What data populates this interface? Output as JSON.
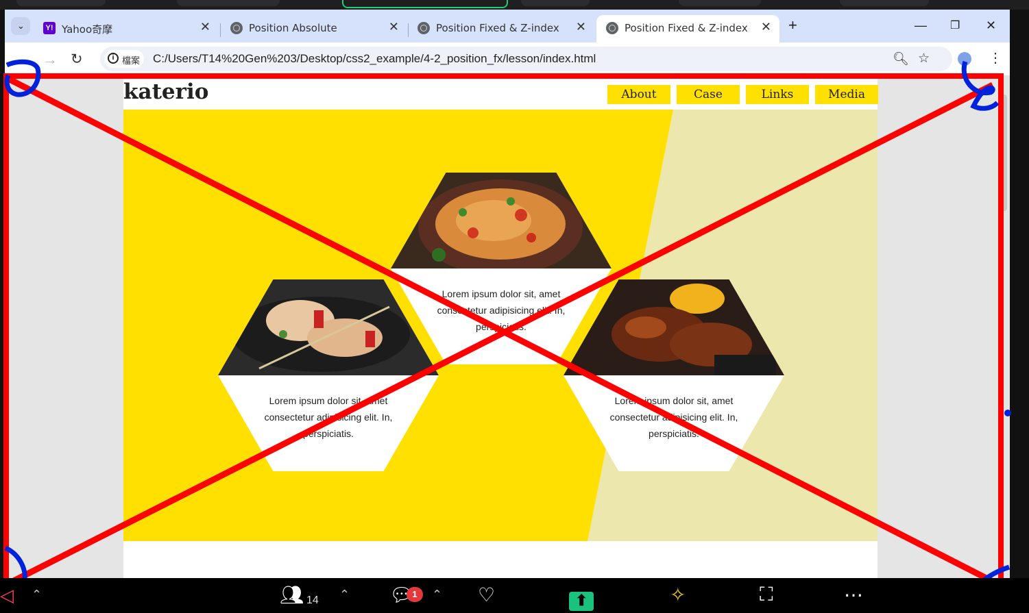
{
  "browser": {
    "tabs": [
      {
        "label": "Yahoo奇摩",
        "favicon": "yahoo-icon"
      },
      {
        "label": "Position Absolute",
        "favicon": "globe-icon"
      },
      {
        "label": "Position Fixed & Z-index",
        "favicon": "globe-icon"
      },
      {
        "label": "Position Fixed & Z-index",
        "favicon": "globe-icon",
        "active": true
      }
    ],
    "new_tab_glyph": "+",
    "address": {
      "scheme_chip": "檔案",
      "url": "C:/Users/T14%20Gen%203/Desktop/css2_example/4-2_position_fx/lesson/index.html"
    }
  },
  "page": {
    "logo": "katerio",
    "nav": [
      "About",
      "Case",
      "Links",
      "Media"
    ],
    "colors": {
      "accent": "#ffe000",
      "pale": "#ebe7ad"
    },
    "cards": [
      {
        "caption": "Lorem ipsum dolor sit, amet consectetur adipisicing elit. In, perspiciatis.",
        "image": "pasta-dish"
      },
      {
        "caption": "Lorem ipsum dolor sit, amet consectetur adipisicing elit. In, perspiciatis.",
        "image": "chicken-skewers"
      },
      {
        "caption": "Lorem ipsum dolor sit, amet consectetur adipisicing elit. In, perspiciatis.",
        "image": "glazed-chicken-wings"
      }
    ]
  },
  "meeting_bar": {
    "participants_count": "14",
    "chat_badge": "1"
  },
  "annotation": {
    "colors": {
      "cross": "#ff0000",
      "marks": "#0022dd"
    }
  }
}
